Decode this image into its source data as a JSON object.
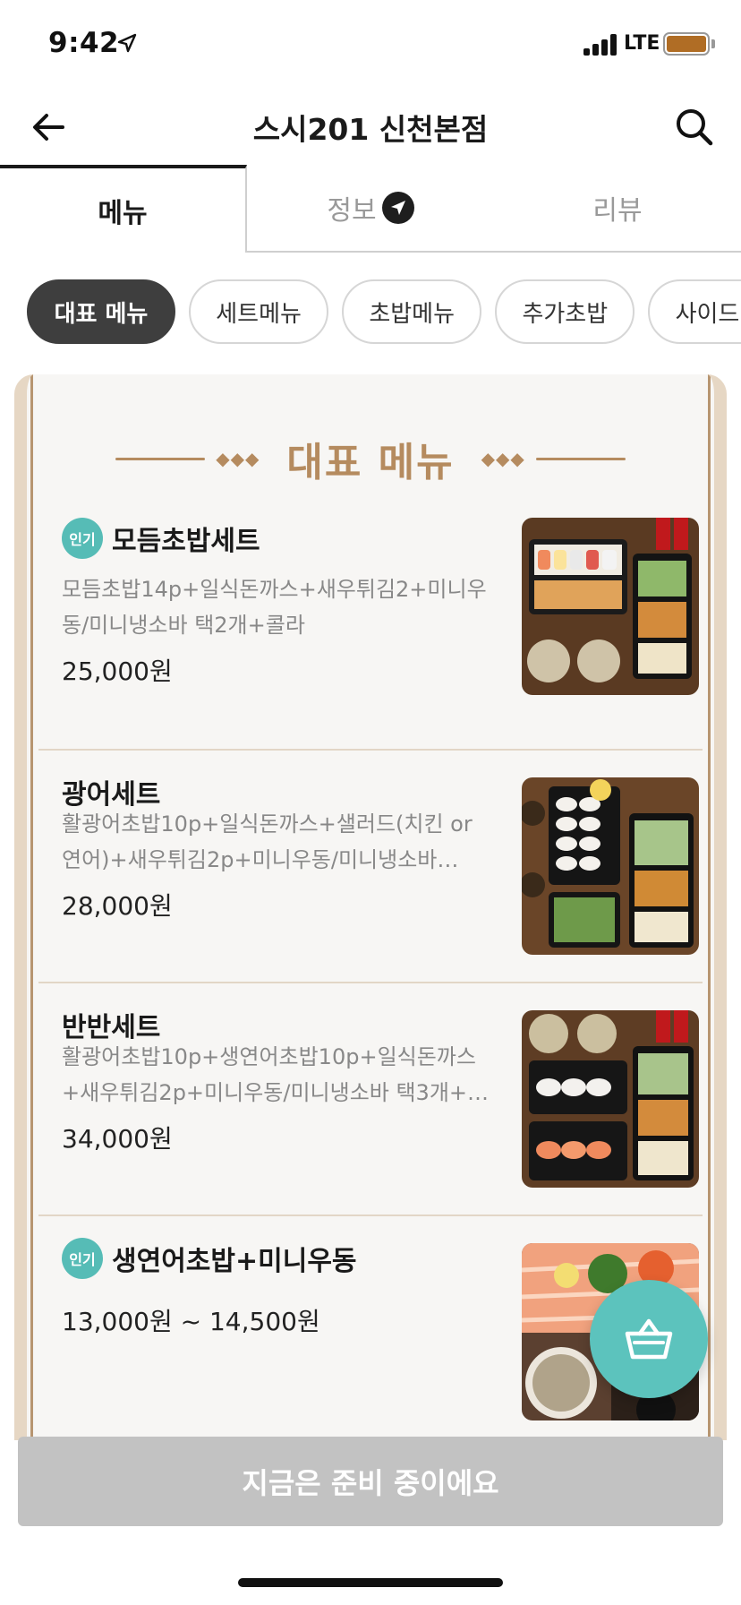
{
  "status_bar": {
    "time": "9:42",
    "network": "LTE",
    "battery_color": "#b06d25"
  },
  "header": {
    "title": "스시201 신천본점",
    "back_icon": "arrow-left-icon",
    "search_icon": "search-icon"
  },
  "tabs": [
    {
      "label": "메뉴",
      "active": true
    },
    {
      "label": "정보",
      "active": false,
      "badge_icon": "send-icon"
    },
    {
      "label": "리뷰",
      "active": false
    }
  ],
  "categories": [
    {
      "label": "대표 메뉴",
      "active": true
    },
    {
      "label": "세트메뉴",
      "active": false
    },
    {
      "label": "초밥메뉴",
      "active": false
    },
    {
      "label": "추가초밥",
      "active": false
    },
    {
      "label": "사이드메뉴",
      "active": false
    }
  ],
  "section": {
    "title": "대표 메뉴",
    "accent_color": "#b58b5f"
  },
  "menu_items": [
    {
      "badge": "인기",
      "name": "모듬초밥세트",
      "desc_line1": "모듬초밥14p+일식돈까스+새우튀김2+미니우",
      "desc_line2": "동/미니냉소바 택2개+콜라",
      "price": "25,000원"
    },
    {
      "badge": "",
      "name": "광어세트",
      "desc_line1": "활광어초밥10p+일식돈까스+샐러드(치킨 or",
      "desc_line2": "연어)+새우튀김2p+미니우동/미니냉소바…",
      "price": "28,000원"
    },
    {
      "badge": "",
      "name": "반반세트",
      "desc_line1": "활광어초밥10p+생연어초밥10p+일식돈까스",
      "desc_line2": "+새우튀김2p+미니우동/미니냉소바 택3개+…",
      "price": "34,000원"
    },
    {
      "badge": "인기",
      "name": "생연어초밥+미니우동",
      "desc_line1": "",
      "desc_line2": "",
      "price": "13,000원 ~ 14,500원"
    }
  ],
  "cart_button": {
    "icon": "shopping-basket-icon",
    "color": "#5cc3bd"
  },
  "order_bar": {
    "label": "지금은 준비 중이에요",
    "color": "#c2c2c2"
  }
}
